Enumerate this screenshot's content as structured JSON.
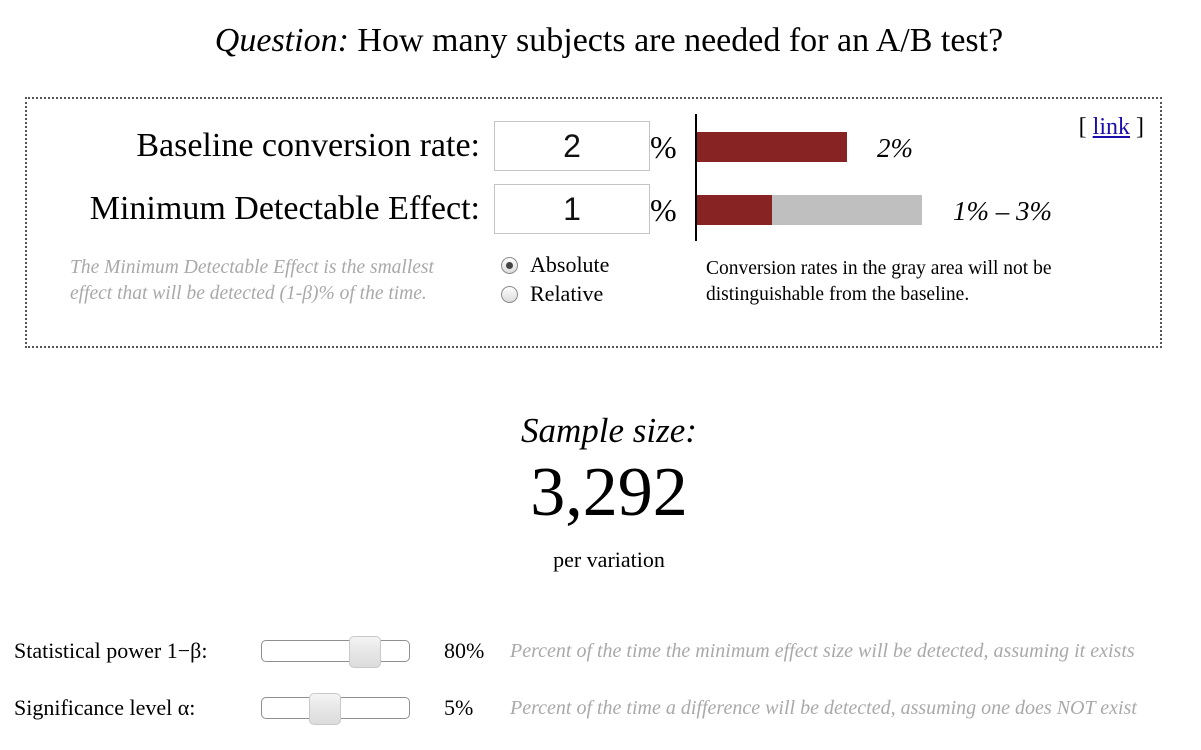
{
  "question": {
    "label": "Question:",
    "text": "How many subjects are needed for an A/B test?"
  },
  "baseline": {
    "label": "Baseline conversion rate:",
    "value": "2",
    "unit": "%",
    "bar_label": "2%",
    "bar_fraction": 0.02
  },
  "mde": {
    "label": "Minimum Detectable Effect:",
    "value": "1",
    "unit": "%",
    "bar_label": "1% – 3%",
    "range_low": 0.01,
    "range_high": 0.03
  },
  "link_label": "link",
  "hint": "The Minimum Detectable Effect is the smallest effect that will be detected (1-β)% of the time.",
  "mode": {
    "options": [
      "Absolute",
      "Relative"
    ],
    "selected": "Absolute"
  },
  "gray_note": "Conversion rates in the gray area will not be distinguishable from the baseline.",
  "result": {
    "title": "Sample size:",
    "value": "3,292",
    "unit": "per variation"
  },
  "power": {
    "label": "Statistical power 1−β:",
    "value": "80%",
    "level": 0.8,
    "description": "Percent of the time the minimum effect size will be detected, assuming it exists"
  },
  "significance": {
    "label": "Significance level α:",
    "value": "5%",
    "level": 0.05,
    "description": "Percent of the time a difference will be detected, assuming one does NOT exist"
  },
  "colors": {
    "bar_red": "#882323",
    "bar_gray": "#bfbfbf",
    "link": "#1a0dab",
    "hint_text": "#a9a9a9"
  }
}
